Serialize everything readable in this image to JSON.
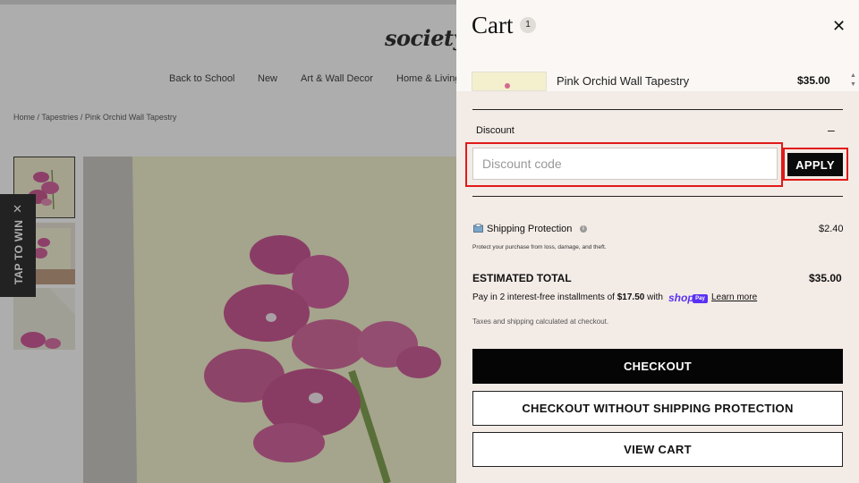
{
  "store": {
    "logo": "society",
    "nav": [
      "Back to School",
      "New",
      "Art & Wall Decor",
      "Home & Living"
    ],
    "breadcrumb": "Home / Tapestries / Pink Orchid Wall Tapestry",
    "tap_to_win": "TAP TO WIN"
  },
  "cart": {
    "title": "Cart",
    "count": "1",
    "item": {
      "name": "Pink Orchid Wall Tapestry",
      "price": "$35.00"
    },
    "discount": {
      "label": "Discount",
      "toggle": "–",
      "placeholder": "Discount code",
      "value": "",
      "apply_label": "APPLY"
    },
    "shipping": {
      "label": "Shipping Protection",
      "price": "$2.40",
      "description": "Protect your purchase from loss, damage, and theft."
    },
    "total": {
      "label": "ESTIMATED TOTAL",
      "price": "$35.00"
    },
    "installments": {
      "prefix": "Pay in 2 interest-free installments of ",
      "amount": "$17.50",
      "suffix": " with",
      "shop_logo": "shop",
      "shop_badge": "Pay",
      "learn_more": "Learn more"
    },
    "taxes_note": "Taxes and shipping calculated at checkout.",
    "buttons": {
      "checkout": "CHECKOUT",
      "checkout_no_protection": "CHECKOUT WITHOUT SHIPPING PROTECTION",
      "view_cart": "VIEW CART"
    }
  },
  "colors": {
    "drawer_bg": "#f3ebe6",
    "highlight": "#e11a1a",
    "shop_pay": "#5a31f4",
    "button_dark": "#050505"
  },
  "icons": [
    "close-icon",
    "info-icon",
    "shipping-protection-icon",
    "collapse-icon",
    "tap-close-icon"
  ]
}
